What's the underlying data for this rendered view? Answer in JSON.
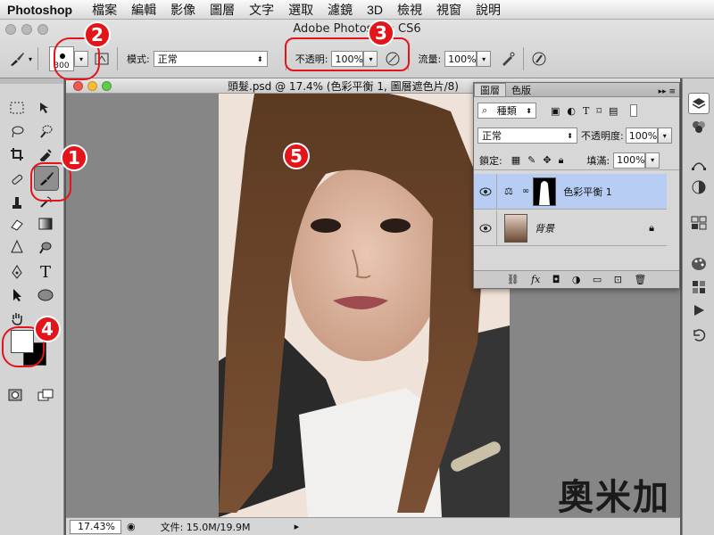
{
  "menubar": {
    "app_name": "Photoshop",
    "items": [
      "檔案",
      "編輯",
      "影像",
      "圖層",
      "文字",
      "選取",
      "濾鏡",
      "3D",
      "檢視",
      "視窗",
      "說明"
    ]
  },
  "window": {
    "title": "Adobe Photoshop CS6"
  },
  "options_bar": {
    "brush_size": "300",
    "mode_label": "模式:",
    "mode_value": "正常",
    "opacity_label": "不透明:",
    "opacity_value": "100%",
    "flow_label": "流量:",
    "flow_value": "100%"
  },
  "document": {
    "title": "頭髮.psd @ 17.4% (色彩平衡 1, 圖層遮色片/8)",
    "zoom": "17.43%",
    "doc_info": "文件: 15.0M/19.9M"
  },
  "layers_panel": {
    "tabs": [
      "圖層",
      "色版"
    ],
    "filter_kind": "種類",
    "blend_mode": "正常",
    "opacity_label": "不透明度:",
    "opacity_value": "100%",
    "lock_label": "鎖定:",
    "fill_label": "填滿:",
    "fill_value": "100%",
    "layers": [
      {
        "name": "色彩平衡 1",
        "selected": true
      },
      {
        "name": "背景",
        "selected": false
      }
    ]
  },
  "callouts": [
    "1",
    "2",
    "3",
    "4",
    "5"
  ],
  "watermark": "奧米加",
  "colors": {
    "callout_red": "#e3141a",
    "selection_blue": "#b7cdf4"
  }
}
